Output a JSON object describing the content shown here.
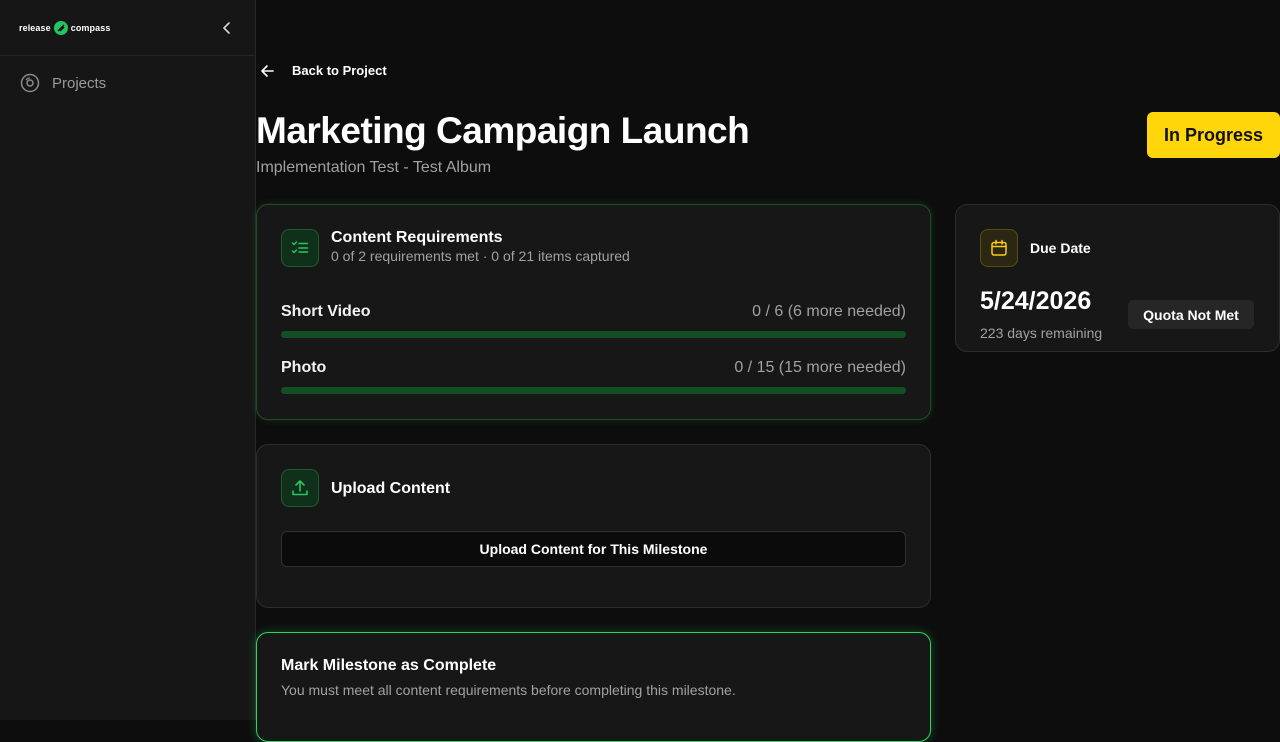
{
  "sidebar": {
    "logo_left": "release",
    "logo_right": "compass",
    "items": [
      {
        "label": "Projects",
        "icon": "projects-icon"
      }
    ]
  },
  "header": {
    "back_label": "Back to Project",
    "title": "Marketing Campaign Launch",
    "subtitle": "Implementation Test - Test Album",
    "status": "In Progress"
  },
  "requirements": {
    "title": "Content Requirements",
    "summary": "0 of 2 requirements met · 0 of 21 items captured",
    "items": [
      {
        "label": "Short Video",
        "count": "0 / 6 (6 more needed)",
        "progress": 0
      },
      {
        "label": "Photo",
        "count": "0 / 15 (15 more needed)",
        "progress": 0
      }
    ]
  },
  "upload": {
    "title": "Upload Content",
    "button_label": "Upload Content for This Milestone"
  },
  "complete": {
    "title": "Mark Milestone as Complete",
    "description": "You must meet all content requirements before completing this milestone."
  },
  "due": {
    "title": "Due Date",
    "date": "5/24/2026",
    "remaining": "223 days remaining",
    "badge": "Quota Not Met"
  },
  "colors": {
    "accent_green": "#22c55e",
    "status_yellow": "#ffd60a",
    "background": "#0d0d0d"
  }
}
